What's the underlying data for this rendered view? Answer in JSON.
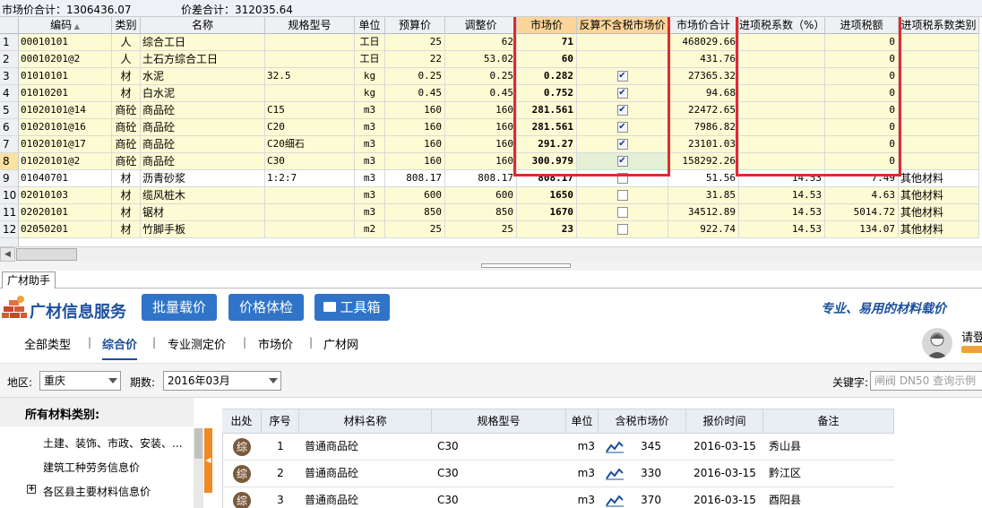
{
  "summary": {
    "market_total": "市场价合计：1306436.07",
    "diff_total": "价差合计：312035.64"
  },
  "grid": {
    "headers": [
      "编码",
      "类别",
      "名称",
      "规格型号",
      "单位",
      "预算价",
      "调整价",
      "市场价",
      "反算不含税市场价",
      "市场价合计",
      "进项税系数（%）",
      "进项税额",
      "进项税系数类别"
    ],
    "rows": [
      {
        "num": "1",
        "code": "00010101",
        "type": "人",
        "name": "综合工日",
        "spec": "",
        "unit": "工日",
        "budget": "25",
        "adjusted": "62",
        "market": "71",
        "checked": false,
        "showcheck": false,
        "total": "468029.66",
        "taxrate": "",
        "taxamt": "0",
        "taxcat": "",
        "color": "yellow"
      },
      {
        "num": "2",
        "code": "00010201@2",
        "type": "人",
        "name": "土石方综合工日",
        "spec": "",
        "unit": "工日",
        "budget": "22",
        "adjusted": "53.02",
        "market": "60",
        "checked": false,
        "showcheck": false,
        "total": "431.76",
        "taxrate": "",
        "taxamt": "0",
        "taxcat": "",
        "color": "yellow"
      },
      {
        "num": "3",
        "code": "01010101",
        "type": "材",
        "name": "水泥",
        "spec": "32.5",
        "unit": "kg",
        "budget": "0.25",
        "adjusted": "0.25",
        "market": "0.282",
        "checked": true,
        "showcheck": true,
        "total": "27365.32",
        "taxrate": "",
        "taxamt": "0",
        "taxcat": "",
        "color": "yellow"
      },
      {
        "num": "4",
        "code": "01010201",
        "type": "材",
        "name": "白水泥",
        "spec": "",
        "unit": "kg",
        "budget": "0.45",
        "adjusted": "0.45",
        "market": "0.752",
        "checked": true,
        "showcheck": true,
        "total": "94.68",
        "taxrate": "",
        "taxamt": "0",
        "taxcat": "",
        "color": "yellow"
      },
      {
        "num": "5",
        "code": "01020101@14",
        "type": "商砼",
        "name": "商品砼",
        "spec": "C15",
        "unit": "m3",
        "budget": "160",
        "adjusted": "160",
        "market": "281.561",
        "checked": true,
        "showcheck": true,
        "total": "22472.65",
        "taxrate": "",
        "taxamt": "0",
        "taxcat": "",
        "color": "yellow"
      },
      {
        "num": "6",
        "code": "01020101@16",
        "type": "商砼",
        "name": "商品砼",
        "spec": "C20",
        "unit": "m3",
        "budget": "160",
        "adjusted": "160",
        "market": "281.561",
        "checked": true,
        "showcheck": true,
        "total": "7986.82",
        "taxrate": "",
        "taxamt": "0",
        "taxcat": "",
        "color": "yellow"
      },
      {
        "num": "7",
        "code": "01020101@17",
        "type": "商砼",
        "name": "商品砼",
        "spec": "C20细石",
        "unit": "m3",
        "budget": "160",
        "adjusted": "160",
        "market": "291.27",
        "checked": true,
        "showcheck": true,
        "total": "23101.03",
        "taxrate": "",
        "taxamt": "0",
        "taxcat": "",
        "color": "yellow"
      },
      {
        "num": "8",
        "code": "01020101@2",
        "type": "商砼",
        "name": "商品砼",
        "spec": "C30",
        "unit": "m3",
        "budget": "160",
        "adjusted": "160",
        "market": "300.979",
        "checked": true,
        "showcheck": true,
        "total": "158292.26",
        "taxrate": "",
        "taxamt": "0",
        "taxcat": "",
        "color": "yellow",
        "selected": true
      },
      {
        "num": "9",
        "code": "01040701",
        "type": "材",
        "name": "沥青砂浆",
        "spec": "1:2:7",
        "unit": "m3",
        "budget": "808.17",
        "adjusted": "808.17",
        "market": "808.17",
        "checked": false,
        "showcheck": true,
        "total": "51.56",
        "taxrate": "14.53",
        "taxamt": "7.49",
        "taxcat": "其他材料",
        "color": "white"
      },
      {
        "num": "10",
        "code": "02010103",
        "type": "材",
        "name": "缆风桩木",
        "spec": "",
        "unit": "m3",
        "budget": "600",
        "adjusted": "600",
        "market": "1650",
        "checked": false,
        "showcheck": true,
        "total": "31.85",
        "taxrate": "14.53",
        "taxamt": "4.63",
        "taxcat": "其他材料",
        "color": "yellow"
      },
      {
        "num": "11",
        "code": "02020101",
        "type": "材",
        "name": "锯材",
        "spec": "",
        "unit": "m3",
        "budget": "850",
        "adjusted": "850",
        "market": "1670",
        "checked": false,
        "showcheck": true,
        "total": "34512.89",
        "taxrate": "14.53",
        "taxamt": "5014.72",
        "taxcat": "其他材料",
        "color": "yellow"
      },
      {
        "num": "12",
        "code": "02050201",
        "type": "材",
        "name": "竹脚手板",
        "spec": "",
        "unit": "m2",
        "budget": "25",
        "adjusted": "25",
        "market": "23",
        "checked": false,
        "showcheck": true,
        "total": "922.74",
        "taxrate": "14.53",
        "taxamt": "134.07",
        "taxcat": "其他材料",
        "color": "yellow"
      }
    ]
  },
  "helper": {
    "tab_label": "广材助手",
    "brand": "广材信息服务",
    "btn_batch": "批量载价",
    "btn_check": "价格体检",
    "btn_tools": "工具箱",
    "slogan": "专业、易用的材料载价",
    "login": "请登"
  },
  "nav": {
    "links": [
      "全部类型",
      "综合价",
      "专业测定价",
      "市场价",
      "广材网"
    ],
    "active": 1
  },
  "filters": {
    "region_label": "地区:",
    "region_value": "重庆",
    "period_label": "期数:",
    "period_value": "2016年03月",
    "keyword_label": "关键字:",
    "keyword_placeholder": "闸阀 DN50 查询示例"
  },
  "categories": {
    "title": "所有材料类别:",
    "items": [
      "土建、装饰、市政、安装、...",
      "建筑工种劳务信息价",
      "各区县主要材料信息价"
    ]
  },
  "results": {
    "headers": [
      "出处",
      "序号",
      "材料名称",
      "规格型号",
      "单位",
      "含税市场价",
      "报价时间",
      "备注"
    ],
    "rows": [
      {
        "src": "综",
        "num": "1",
        "name": "普通商品砼",
        "spec": "C30",
        "unit": "m3",
        "price": "345",
        "date": "2016-03-15",
        "note": "秀山县"
      },
      {
        "src": "综",
        "num": "2",
        "name": "普通商品砼",
        "spec": "C30",
        "unit": "m3",
        "price": "330",
        "date": "2016-03-15",
        "note": "黔江区"
      },
      {
        "src": "综",
        "num": "3",
        "name": "普通商品砼",
        "spec": "C30",
        "unit": "m3",
        "price": "370",
        "date": "2016-03-15",
        "note": "酉阳县"
      }
    ]
  },
  "colors": {
    "highlight_box": "#e02b2b",
    "brand_blue": "#1b4f9c",
    "button_blue": "#2f74c8",
    "orange": "#f08a24"
  },
  "icons": {
    "tools": "toolbox-icon",
    "trend": "trend-chart-icon",
    "avatar": "user-avatar-icon",
    "logo": "brick-wall-logo-icon"
  }
}
